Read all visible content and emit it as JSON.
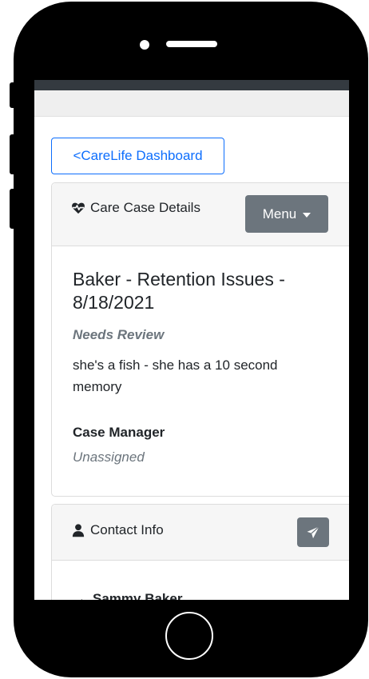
{
  "back_button": {
    "label": "<CareLife Dashboard"
  },
  "case_card": {
    "header_title": "Care Case Details",
    "menu_label": "Menu",
    "case_title": "Baker - Retention Issues - 8/18/2021",
    "status": "Needs Review",
    "description": "she's a fish - she has a 10 second memory",
    "case_manager_label": "Case Manager",
    "case_manager_value": "Unassigned"
  },
  "contact_card": {
    "header_title": "Contact Info",
    "contact_arrow": "→",
    "contact_name": "Sammy Baker"
  },
  "colors": {
    "primary": "#0d6efd",
    "secondary": "#6c757d",
    "dark_bar": "#343a40"
  },
  "icons": {
    "case_header": "heartbeat-icon",
    "contact_header": "user-icon",
    "send": "paper-plane-icon"
  }
}
